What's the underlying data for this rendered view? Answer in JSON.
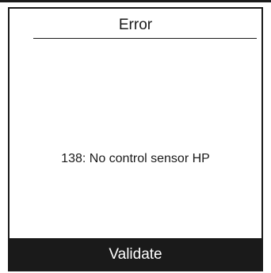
{
  "dialog": {
    "title": "Error",
    "message": "138: No control sensor HP",
    "validate_label": "Validate"
  },
  "colors": {
    "foreground": "#1a1a1a",
    "background": "#ffffff",
    "button_text": "#ffffff"
  }
}
